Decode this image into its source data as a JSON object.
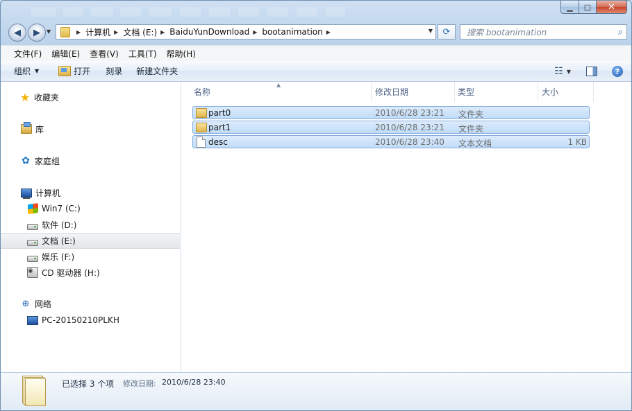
{
  "window": {
    "caption_min": "▁",
    "caption_max": "□",
    "caption_close": "✕"
  },
  "address": {
    "crumbs": [
      "计算机",
      "文档 (E:)",
      "BaiduYunDownload",
      "bootanimation"
    ]
  },
  "search": {
    "placeholder": "搜索 bootanimation"
  },
  "menu": [
    "文件(F)",
    "编辑(E)",
    "查看(V)",
    "工具(T)",
    "帮助(H)"
  ],
  "toolbar": {
    "organize": "组织",
    "open": "打开",
    "burn": "刻录",
    "new_folder": "新建文件夹"
  },
  "nav": {
    "favorites": "收藏夹",
    "libraries": "库",
    "homegroup": "家庭组",
    "computer": "计算机",
    "drives": [
      {
        "label": "Win7 (C:)",
        "icon": "windows-drive-icon"
      },
      {
        "label": "软件 (D:)",
        "icon": "drive-icon"
      },
      {
        "label": "文档 (E:)",
        "icon": "drive-icon",
        "selected": true
      },
      {
        "label": "娱乐 (F:)",
        "icon": "drive-icon"
      },
      {
        "label": "CD 驱动器 (H:)",
        "icon": "cd-drive-icon"
      }
    ],
    "network": "网络",
    "network_pc": "PC-20150210PLKH"
  },
  "columns": {
    "name": "名称",
    "modified": "修改日期",
    "type": "类型",
    "size": "大小"
  },
  "files": [
    {
      "name": "part0",
      "modified": "2010/6/28 23:21",
      "type": "文件夹",
      "size": "",
      "kind": "folder"
    },
    {
      "name": "part1",
      "modified": "2010/6/28 23:21",
      "type": "文件夹",
      "size": "",
      "kind": "folder"
    },
    {
      "name": "desc",
      "modified": "2010/6/28 23:40",
      "type": "文本文档",
      "size": "1 KB",
      "kind": "file"
    }
  ],
  "details": {
    "selection": "已选择 3 个项",
    "modified_label": "修改日期:",
    "modified_value": "2010/6/28 23:40"
  },
  "colors": {
    "selection_bg": "#c9e0fa",
    "selection_border": "#84acdd",
    "chrome": "#c6daef"
  }
}
